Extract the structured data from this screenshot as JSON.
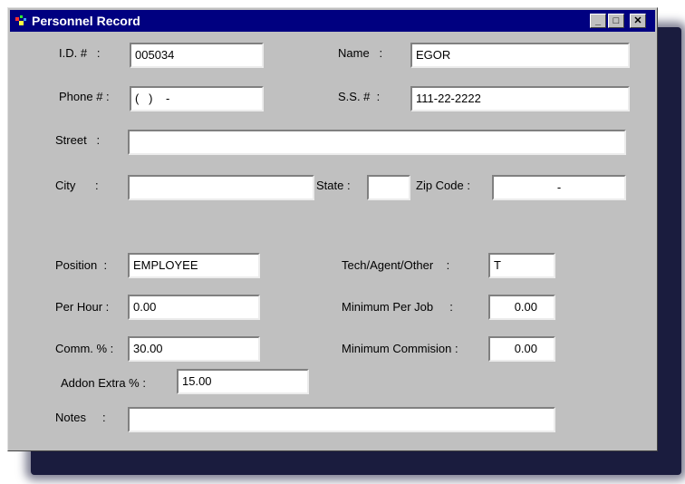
{
  "window": {
    "title": "Personnel Record",
    "minimize_glyph": "_",
    "maximize_glyph": "□",
    "close_glyph": "✕"
  },
  "labels": {
    "id": "I.D. #   :",
    "name": "Name   :",
    "phone": "Phone # :",
    "ss": "S.S. #  :",
    "street": "Street   :",
    "city": "City      :",
    "state": "State :",
    "zip": "Zip Code :",
    "position": "Position  :",
    "tech": "Tech/Agent/Other    :",
    "per_hour": "Per Hour :",
    "min_per_job": "Minimum Per Job     :",
    "comm": "Comm. % :",
    "min_commission": "Minimum Commision :",
    "addon": "Addon Extra % :",
    "notes": "Notes     :"
  },
  "fields": {
    "id": "005034",
    "name": "EGOR",
    "phone": "(   )    -",
    "ss": "111-22-2222",
    "street": "",
    "city": "",
    "state": "",
    "zip": "-",
    "position": "EMPLOYEE",
    "tech": "T",
    "per_hour": "0.00",
    "min_per_job": "0.00",
    "comm": "30.00",
    "min_commission": "0.00",
    "addon": "15.00",
    "notes": ""
  },
  "colors": {
    "titlebar": "#000080",
    "window_bg": "#c0c0c0",
    "shadow": "#1a1c3e"
  },
  "icons": {
    "title": "app-icon"
  }
}
